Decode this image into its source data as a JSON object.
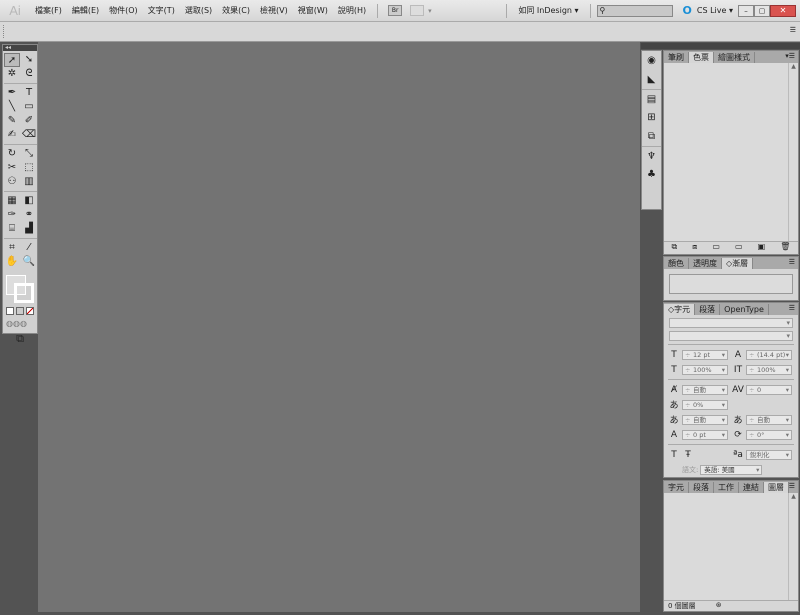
{
  "app": {
    "logo": "Ai",
    "workspace": "如同 InDesign",
    "cs_live": "CS Live"
  },
  "menu": [
    "檔案(F)",
    "編輯(E)",
    "物件(O)",
    "文字(T)",
    "選取(S)",
    "效果(C)",
    "檢視(V)",
    "視窗(W)",
    "說明(H)"
  ],
  "menu_buttons": [
    "Br"
  ],
  "toolbar": {
    "collapse": "◂◂",
    "tools": [
      "➚",
      "➘",
      "✲",
      "ᘓ",
      "✒",
      "T",
      "╲",
      "▭",
      "✎",
      "✐",
      "✍",
      "⌫",
      "↻",
      "⤡",
      "✂",
      "⬚",
      "⚇",
      "▥",
      "▦",
      "◧",
      "✑",
      "⚭",
      "⌸",
      "▟",
      "⌗",
      "⁄",
      "✋",
      "🔍"
    ]
  },
  "icon_column": [
    "◉",
    "◣",
    "▤",
    "⊞",
    "⧉",
    "♆",
    "♣"
  ],
  "panel_swatches": {
    "tabs": [
      "筆刷",
      "色票",
      "繪圖樣式"
    ],
    "active": 1,
    "footer_icons": [
      "⧉",
      "⧈",
      "▭",
      "▭",
      "▣",
      "🗑"
    ]
  },
  "panel_gradient": {
    "tabs": [
      "顏色",
      "透明度",
      "◇漸層"
    ],
    "active": 2
  },
  "panel_character": {
    "tabs": [
      "◇字元",
      "段落",
      "OpenType"
    ],
    "active": 0,
    "font_size": "12 pt",
    "leading": "(14.4 pt)",
    "h_scale": "100%",
    "v_scale": "100%",
    "kerning": "自動",
    "tracking": "0",
    "tsume": "0%",
    "aki_left": "自動",
    "aki_right": "自動",
    "baseline": "0 pt",
    "rotation": "0°",
    "anti_alias": "銳利化",
    "language_label": "語文:",
    "language": "英語: 美國"
  },
  "panel_layers": {
    "tabs": [
      "字元",
      "段落",
      "工作",
      "連結",
      "圖層"
    ],
    "active": 4,
    "status": "0 個圖層"
  },
  "colors": {
    "canvas": "#737373",
    "frame": "#535353",
    "panel": "#d6d6d6",
    "close": "#d9534f"
  }
}
